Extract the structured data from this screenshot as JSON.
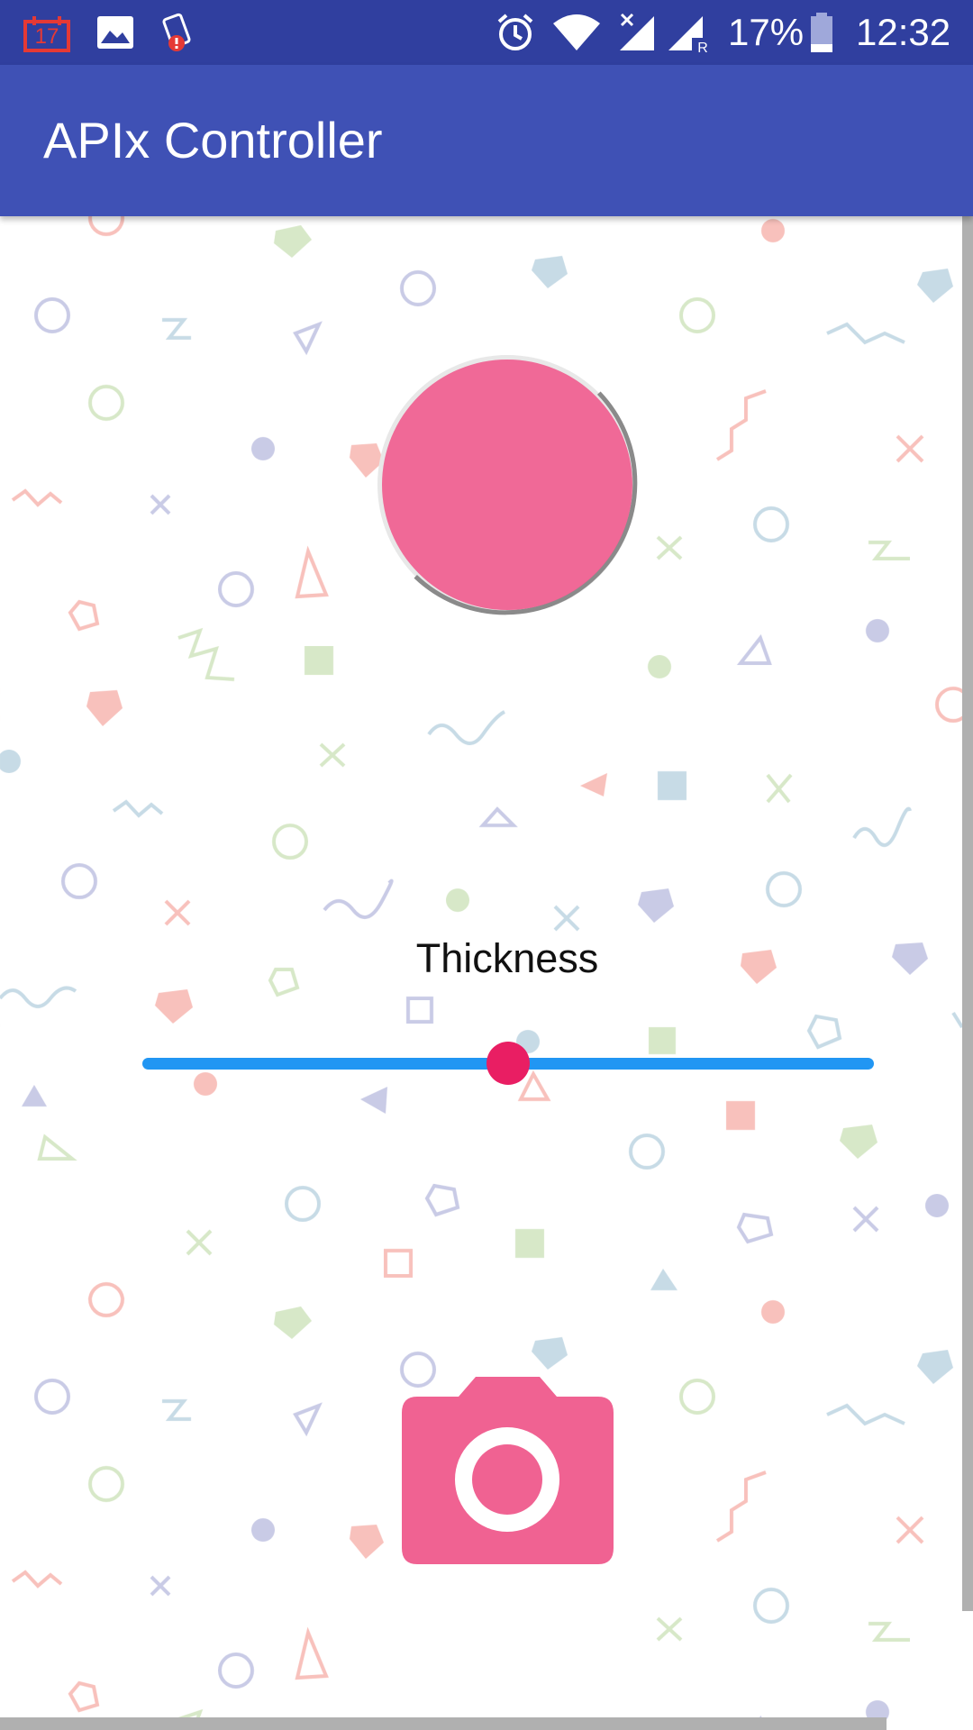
{
  "status_bar": {
    "notification_icons": [
      "calendar-17-icon",
      "image-icon",
      "battery-alert-icon"
    ],
    "system_icons": [
      "alarm-icon",
      "wifi-icon",
      "cell-signal-icon",
      "roaming-signal-icon",
      "battery-icon"
    ],
    "calendar_day": "17",
    "roaming_label": "R",
    "battery_percent": "17%",
    "time": "12:32"
  },
  "app_bar": {
    "title": "APIx Controller"
  },
  "controls": {
    "color_circle_icon": "color-picker-circle",
    "thickness_label": "Thickness",
    "slider_value": 0.5,
    "camera_icon": "camera-icon"
  },
  "colors": {
    "status_bar": "#303f9f",
    "app_bar": "#3f51b5",
    "pink": "#f06292",
    "accent_pink": "#e91e63",
    "slider_track": "#2196f3"
  }
}
